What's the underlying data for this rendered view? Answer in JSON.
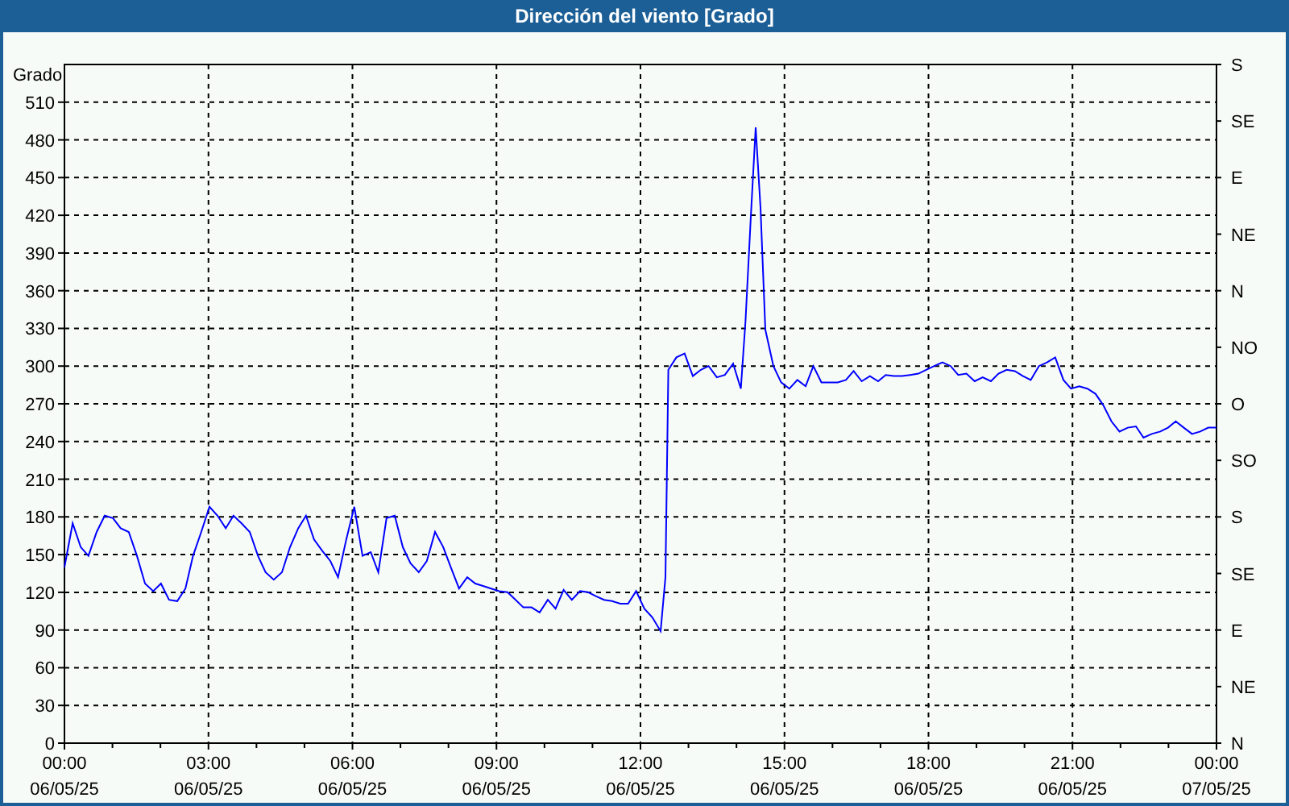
{
  "window": {
    "title": "Dirección del viento [Grado]"
  },
  "chart": {
    "xtick_dates": [
      "06/05/25",
      "06/05/25",
      "06/05/25",
      "06/05/25",
      "06/05/25",
      "06/05/25",
      "06/05/25",
      "06/05/25",
      "07/05/25"
    ],
    "compass_labels": [
      "S",
      "SE",
      "E",
      "NE",
      "N",
      "NO",
      "O",
      "SO",
      "S",
      "SE",
      "E",
      "NE",
      "N"
    ],
    "chart_data": {
      "type": "line",
      "grid": true,
      "ylabel": "Grado",
      "xlim": [
        0,
        24
      ],
      "ylim": [
        0,
        540
      ],
      "yticks": [
        0,
        30,
        60,
        90,
        120,
        150,
        180,
        210,
        240,
        270,
        300,
        330,
        360,
        390,
        420,
        450,
        480,
        510
      ],
      "xticks": [
        {
          "value": 0,
          "label": "00:00"
        },
        {
          "value": 3,
          "label": "03:00"
        },
        {
          "value": 6,
          "label": "06:00"
        },
        {
          "value": 9,
          "label": "09:00"
        },
        {
          "value": 12,
          "label": "12:00"
        },
        {
          "value": 15,
          "label": "15:00"
        },
        {
          "value": 18,
          "label": "18:00"
        },
        {
          "value": 21,
          "label": "21:00"
        },
        {
          "value": 24,
          "label": "00:00"
        }
      ],
      "x": [
        0,
        0.17,
        0.34,
        0.5,
        0.67,
        0.84,
        1.01,
        1.17,
        1.34,
        1.51,
        1.68,
        1.85,
        2.01,
        2.18,
        2.35,
        2.52,
        2.68,
        2.85,
        3.02,
        3.19,
        3.36,
        3.52,
        3.69,
        3.86,
        4.03,
        4.19,
        4.36,
        4.53,
        4.7,
        4.87,
        5.03,
        5.2,
        5.37,
        5.54,
        5.7,
        5.87,
        6.04,
        6.21,
        6.38,
        6.54,
        6.71,
        6.88,
        7.05,
        7.21,
        7.38,
        7.55,
        7.72,
        7.89,
        8.05,
        8.22,
        8.39,
        8.56,
        8.72,
        8.89,
        9.06,
        9.23,
        9.4,
        9.56,
        9.73,
        9.9,
        10.07,
        10.23,
        10.4,
        10.57,
        10.74,
        10.91,
        11.07,
        11.24,
        11.41,
        11.58,
        11.74,
        11.91,
        12.08,
        12.25,
        12.42,
        12.52,
        12.58,
        12.75,
        12.92,
        13.09,
        13.26,
        13.42,
        13.59,
        13.76,
        13.93,
        14.09,
        14.19,
        14.3,
        14.4,
        14.5,
        14.6,
        14.77,
        14.93,
        15.1,
        15.27,
        15.44,
        15.6,
        15.77,
        15.94,
        16.11,
        16.28,
        16.44,
        16.61,
        16.78,
        16.95,
        17.11,
        17.28,
        17.45,
        17.62,
        17.79,
        17.95,
        18.12,
        18.29,
        18.46,
        18.62,
        18.79,
        18.96,
        19.13,
        19.3,
        19.46,
        19.63,
        19.8,
        19.97,
        20.13,
        20.3,
        20.47,
        20.64,
        20.81,
        20.97,
        21.14,
        21.31,
        21.48,
        21.64,
        21.81,
        21.98,
        22.15,
        22.32,
        22.48,
        22.65,
        22.83,
        22.99,
        23.15,
        23.32,
        23.49,
        23.66,
        23.83,
        24
      ],
      "series": [
        {
          "color": "#0000ff",
          "values": [
            140,
            175,
            156,
            149,
            168,
            181,
            179,
            171,
            168,
            149,
            127,
            121,
            127,
            114,
            113,
            123,
            149,
            168,
            188,
            181,
            171,
            181,
            175,
            168,
            149,
            136,
            130,
            136,
            156,
            171,
            181,
            162,
            153,
            145,
            132,
            162,
            188,
            149,
            152,
            136,
            179,
            181,
            156,
            143,
            136,
            145,
            168,
            156,
            140,
            123,
            132,
            127,
            125,
            123,
            121,
            120,
            114,
            108,
            108,
            104,
            114,
            107,
            122,
            114,
            121,
            120,
            117,
            114,
            113,
            111,
            111,
            121,
            107,
            100,
            89,
            132,
            297,
            307,
            310,
            292,
            297,
            300,
            291,
            293,
            302,
            282,
            336,
            419,
            490,
            426,
            329,
            300,
            287,
            282,
            289,
            284,
            300,
            287,
            287,
            287,
            289,
            296,
            288,
            292,
            288,
            293,
            292,
            292,
            293,
            294,
            297,
            300,
            303,
            300,
            293,
            294,
            288,
            291,
            288,
            294,
            297,
            296,
            292,
            289,
            300,
            303,
            307,
            289,
            282,
            284,
            282,
            278,
            269,
            256,
            248,
            251,
            252,
            243,
            246,
            248,
            251,
            256,
            251,
            246,
            248,
            251,
            251
          ]
        }
      ]
    }
  }
}
